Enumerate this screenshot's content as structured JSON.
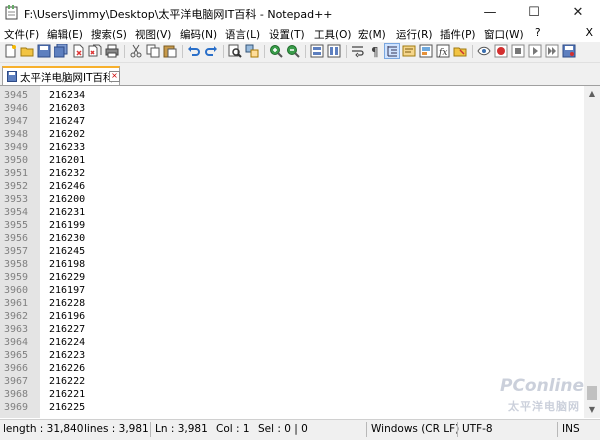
{
  "window": {
    "title": "F:\\Users\\Jimmy\\Desktop\\太平洋电脑网IT百科 - Notepad++",
    "minimize": "—",
    "maximize": "☐",
    "close": "✕"
  },
  "menu": {
    "items": [
      "文件(F)",
      "编辑(E)",
      "搜索(S)",
      "视图(V)",
      "编码(N)",
      "语言(L)",
      "设置(T)",
      "工具(O)",
      "宏(M)",
      "运行(R)",
      "插件(P)",
      "窗口(W)",
      "?"
    ],
    "close": "X"
  },
  "toolbar": {
    "icons": [
      "new-file-icon",
      "open-file-icon",
      "save-icon",
      "save-all-icon",
      "close-icon",
      "close-all-icon",
      "print-icon",
      "cut-icon",
      "copy-icon",
      "paste-icon",
      "undo-icon",
      "redo-icon",
      "find-icon",
      "replace-icon",
      "zoom-in-icon",
      "zoom-out-icon",
      "sync-vertical-icon",
      "sync-horizontal-icon",
      "word-wrap-icon",
      "show-all-chars-icon",
      "indent-guide-icon",
      "user-lang-icon",
      "doc-map-icon",
      "function-list-icon",
      "folder-workspace-icon",
      "monitor-icon",
      "record-macro-icon",
      "stop-macro-icon",
      "play-macro-icon",
      "run-macro-multiple-icon",
      "save-macro-icon"
    ]
  },
  "tab": {
    "label": "太平洋电脑网IT百科",
    "close": "×"
  },
  "editor": {
    "lines": [
      {
        "num": "3945",
        "text": "216234"
      },
      {
        "num": "3946",
        "text": "216203"
      },
      {
        "num": "3947",
        "text": "216247"
      },
      {
        "num": "3948",
        "text": "216202"
      },
      {
        "num": "3949",
        "text": "216233"
      },
      {
        "num": "3950",
        "text": "216201"
      },
      {
        "num": "3951",
        "text": "216232"
      },
      {
        "num": "3952",
        "text": "216246"
      },
      {
        "num": "3953",
        "text": "216200"
      },
      {
        "num": "3954",
        "text": "216231"
      },
      {
        "num": "3955",
        "text": "216199"
      },
      {
        "num": "3956",
        "text": "216230"
      },
      {
        "num": "3957",
        "text": "216245"
      },
      {
        "num": "3958",
        "text": "216198"
      },
      {
        "num": "3959",
        "text": "216229"
      },
      {
        "num": "3960",
        "text": "216197"
      },
      {
        "num": "3961",
        "text": "216228"
      },
      {
        "num": "3962",
        "text": "216196"
      },
      {
        "num": "3963",
        "text": "216227"
      },
      {
        "num": "3964",
        "text": "216224"
      },
      {
        "num": "3965",
        "text": "216223"
      },
      {
        "num": "3966",
        "text": "216226"
      },
      {
        "num": "3967",
        "text": "216222"
      },
      {
        "num": "3968",
        "text": "216221"
      },
      {
        "num": "3969",
        "text": "216225"
      }
    ]
  },
  "status": {
    "length": "length : 31,840",
    "lines": "lines : 3,981",
    "ln": "Ln : 3,981",
    "col": "Col : 1",
    "sel": "Sel : 0 | 0",
    "eol": "Windows (CR LF)",
    "encoding": "UTF-8",
    "mode": "INS"
  },
  "watermark": {
    "line1": "PConline",
    "line2": "太平洋电脑网"
  }
}
